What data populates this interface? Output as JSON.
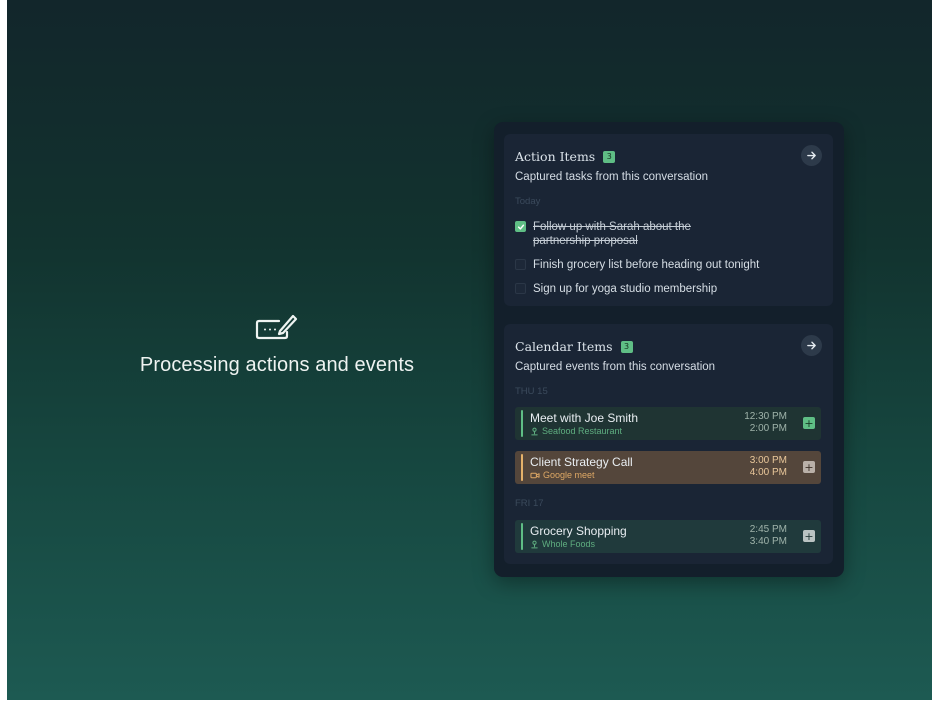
{
  "status": {
    "text": "Processing actions and events",
    "icon": "keyboard-edit-icon"
  },
  "actions_card": {
    "title": "Action Items",
    "count": "3",
    "subtitle": "Captured tasks from this conversation",
    "section_label": "Today",
    "tasks": [
      {
        "text_line1": "Follow up with Sarah about the",
        "text_line2": "partnership proposal",
        "checked": true
      },
      {
        "text": "Finish grocery list before heading out tonight",
        "checked": false
      },
      {
        "text": "Sign up for yoga studio membership",
        "checked": false
      }
    ]
  },
  "calendar_card": {
    "title": "Calendar Items",
    "count": "3",
    "subtitle": "Captured events from this conversation",
    "days": [
      {
        "label": "THU 15",
        "events": [
          {
            "title": "Meet with Joe Smith",
            "location": "Seafood Restaurant",
            "location_icon": "map-pin-icon",
            "start": "12:30 PM",
            "end": "2:00 PM",
            "accent": "#5fbe85"
          },
          {
            "title": "Client Strategy Call",
            "location": "Google meet",
            "location_icon": "video-icon",
            "start": "3:00 PM",
            "end": "4:00 PM",
            "accent": "#e6b26a"
          }
        ]
      },
      {
        "label": "FRI 17",
        "events": [
          {
            "title": "Grocery Shopping",
            "location": "Whole Foods",
            "location_icon": "map-pin-icon",
            "start": "2:45 PM",
            "end": "3:40 PM",
            "accent": "#5fbe85"
          }
        ]
      }
    ]
  },
  "colors": {
    "background_top": "#12262b",
    "background_bottom": "#1d5a52",
    "panel": "#131f2b",
    "card": "#1a2535",
    "accent_green": "#5fbe85",
    "accent_orange": "#e6b26a"
  }
}
